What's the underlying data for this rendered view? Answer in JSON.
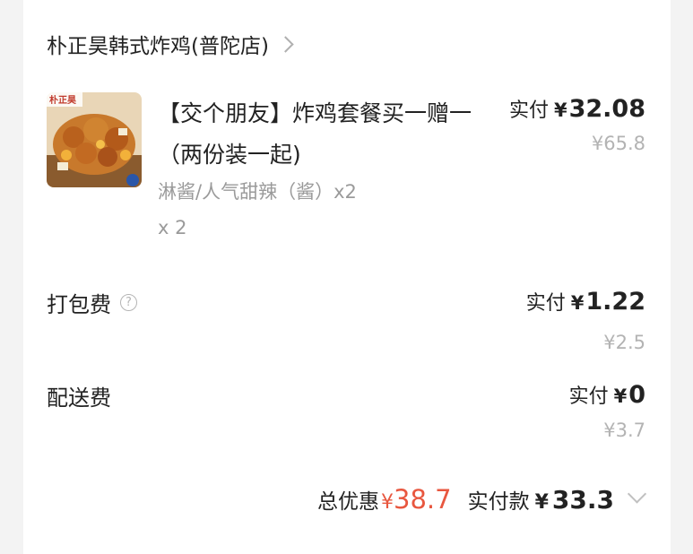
{
  "shop": {
    "name": "朴正昊韩式炸鸡(普陀店)"
  },
  "item": {
    "title": "【交个朋友】炸鸡套餐买一赠一（两份装一起)",
    "spec": "淋酱/人气甜辣（酱）x2",
    "qty": "x 2",
    "pay_label": "实付",
    "currency": "¥",
    "pay_amount": "32.08",
    "original": "¥65.8",
    "thumb_brand": "朴正昊"
  },
  "packing": {
    "label": "打包费",
    "help_icon": "question-circle-icon",
    "pay_label": "实付",
    "currency": "¥",
    "pay_amount": "1.22",
    "original": "¥2.5"
  },
  "delivery": {
    "label": "配送费",
    "pay_label": "实付",
    "currency": "¥",
    "pay_amount": "0",
    "original": "¥3.7"
  },
  "summary": {
    "discount_label": "总优惠",
    "discount_currency": "¥",
    "discount_amount": "38.7",
    "total_label": "实付款",
    "currency": "¥",
    "total_amount": "33.3",
    "expand_icon": "chevron-down-icon"
  },
  "colors": {
    "discount": "#e8573f",
    "muted": "#9a9a9a"
  }
}
